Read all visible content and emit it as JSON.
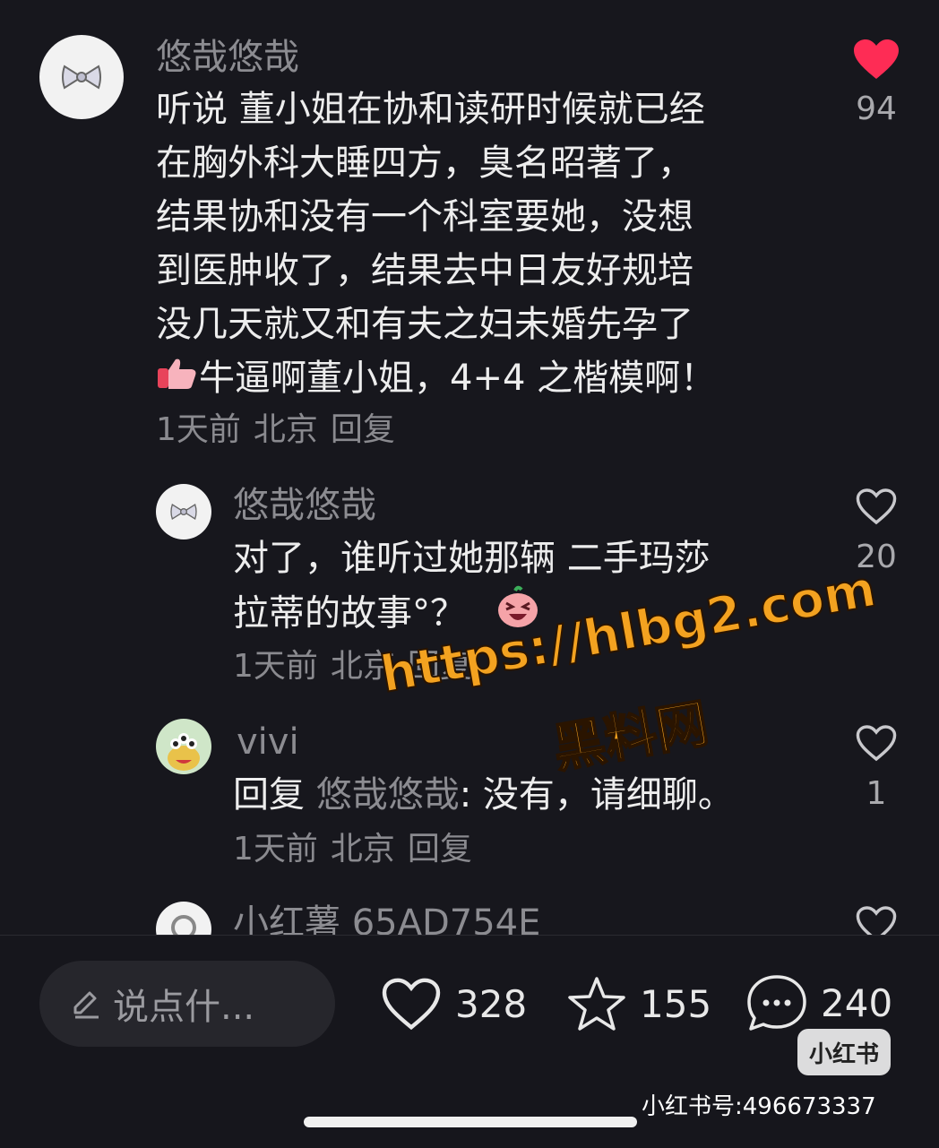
{
  "comments": [
    {
      "author": "悠哉悠哉",
      "lines": [
        "听说 董小姐在协和读研时候就已经",
        "在胸外科大睡四方，臭名昭著了，",
        "结果协和没有一个科室要她，没想",
        "到医肿收了，结果去中日友好规培",
        "没几天就又和有夫之妇未婚先孕了"
      ],
      "last_line": "牛逼啊董小姐，4+4 之楷模啊！",
      "time": "1天前",
      "location": "北京",
      "reply_label": "回复",
      "likes": "94",
      "liked": true
    },
    {
      "author": "悠哉悠哉",
      "lines": [
        "对了，谁听过她那辆 二手玛莎",
        "拉蒂的故事°？"
      ],
      "time": "1天前",
      "location": "北京",
      "reply_label": "回复",
      "likes": "20",
      "liked": false
    },
    {
      "author": "vivi",
      "reply_prefix": "回复",
      "reply_to": "悠哉悠哉",
      "text": ": 没有，请细聊。",
      "time": "1天前",
      "location": "北京",
      "reply_label": "回复",
      "likes": "1",
      "liked": false
    },
    {
      "author": "小红薯 65AD754E"
    }
  ],
  "bottom_bar": {
    "input_placeholder": "说点什...",
    "like_count": "328",
    "star_count": "155",
    "comment_count": "240"
  },
  "watermark": {
    "url": "https://hlbg2.com",
    "name": "黑料网"
  },
  "xhs_mark": {
    "logo": "小红书",
    "id_text": "小红书号:496673337"
  },
  "colors": {
    "background": "#17171d",
    "like_red": "#fe2c55",
    "watermark_orange": "#f3a220"
  }
}
